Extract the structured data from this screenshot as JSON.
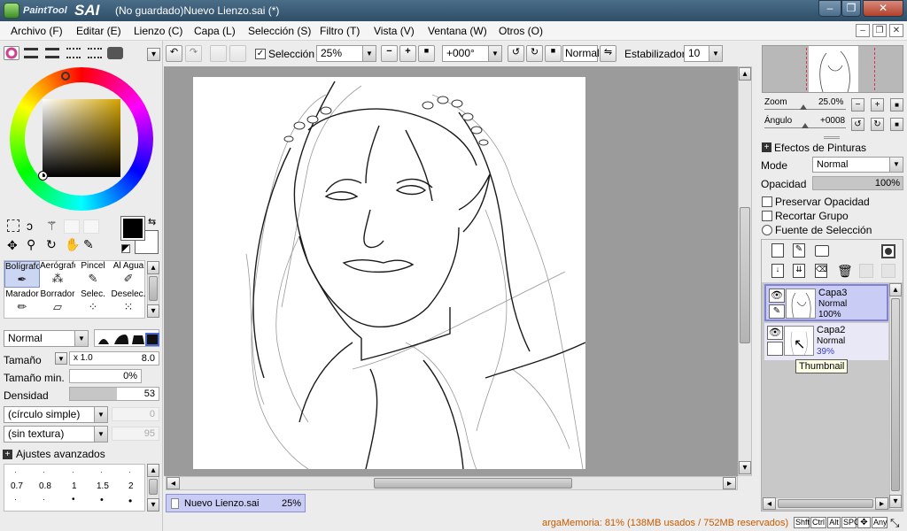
{
  "app": {
    "logo_small": "PaintTool",
    "logo_big": "SAI",
    "window_title": "(No guardado)Nuevo Lienzo.sai (*)"
  },
  "menu": [
    "Archivo (F)",
    "Editar (E)",
    "Lienzo (C)",
    "Capa (L)",
    "Selección (S)",
    "Filtro (T)",
    "Vista (V)",
    "Ventana (W)",
    "Otros (O)"
  ],
  "toolbar": {
    "selection_label": "Selección",
    "selection_checked": true,
    "zoom": "25%",
    "rotation": "+000°",
    "blend": "Normal",
    "stabilizer_label": "Estabilizador",
    "stabilizer_value": "10"
  },
  "tools": {
    "row1": [
      "Bolígrafo",
      "Aerógrafo",
      "Pincel",
      "Al Agua"
    ],
    "row2": [
      "Marador",
      "Borrador",
      "Selec.",
      "Deselec."
    ]
  },
  "brush": {
    "mode": "Normal",
    "size_label": "Tamaño",
    "size_mult": "x 1.0",
    "size_value": "8.0",
    "min_size_label": "Tamaño min.",
    "min_size_value": "0%",
    "density_label": "Densidad",
    "density_value": "53",
    "shape": "(círculo simple)",
    "shape_value": "0",
    "texture": "(sin textura)",
    "texture_value": "95",
    "advanced": "Ajustes avanzados",
    "presets": [
      "0.7",
      "0.8",
      "1",
      "1.5",
      "2"
    ]
  },
  "navigator": {
    "zoom_label": "Zoom",
    "zoom_value": "25.0%",
    "angle_label": "Ángulo",
    "angle_value": "+0008"
  },
  "effects": {
    "header": "Efectos de Pinturas",
    "mode_label": "Mode",
    "mode_value": "Normal",
    "opacity_label": "Opacidad",
    "opacity_value": "100%",
    "preserve_opacity": "Preservar Opacidad",
    "clip_group": "Recortar Grupo",
    "selection_source": "Fuente de Selección"
  },
  "layers": [
    {
      "name": "Capa3",
      "mode": "Normal",
      "opacity": "100%"
    },
    {
      "name": "Capa2",
      "mode": "Normal",
      "opacity": "39%"
    }
  ],
  "tooltip": "Thumbnail",
  "tab": {
    "name": "Nuevo Lienzo.sai",
    "zoom": "25%"
  },
  "status": {
    "memory": "argaMemoria: 81% (138MB usados / 752MB reservados)",
    "keys": [
      "Shft",
      "Ctrl",
      "Alt",
      "SPC",
      "Any"
    ]
  },
  "colors": {
    "accent_selection": "#cbd6f2",
    "layer_selected": "#c9ccf5",
    "status_text": "#c85a00",
    "title_bar": "#3a5a76"
  }
}
